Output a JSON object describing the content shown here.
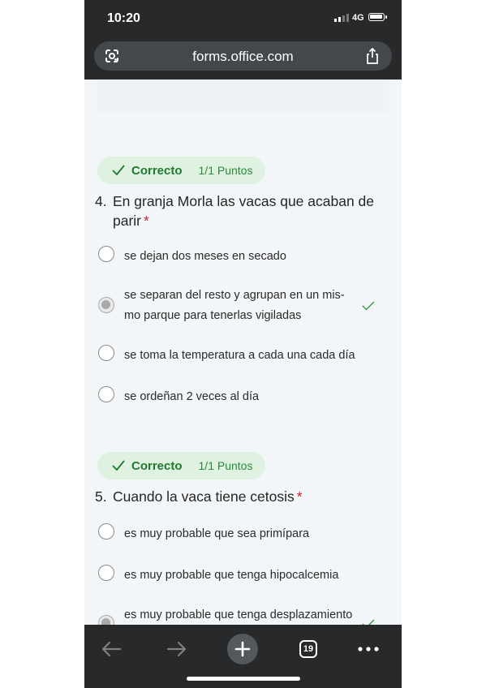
{
  "status_bar": {
    "time": "10:20",
    "network": "4G"
  },
  "browser": {
    "url": "forms.office.com",
    "tab_count": "19"
  },
  "questions": [
    {
      "badge_label": "Correcto",
      "badge_points": "1/1 Puntos",
      "number": "4.",
      "text": "En granja Morla las vacas que acaban de parir",
      "required": "*",
      "options": [
        {
          "text": "se dejan dos meses en secado",
          "selected": false
        },
        {
          "text": "se separan del resto y agrupan en un mis-mo parque para tenerlas vigiladas",
          "selected": true,
          "correct": true
        },
        {
          "text": "se toma la temperatura a cada una cada día",
          "selected": false
        },
        {
          "text": "se ordeñan 2 veces al día",
          "selected": false
        }
      ]
    },
    {
      "badge_label": "Correcto",
      "badge_points": "1/1 Puntos",
      "number": "5.",
      "text": "Cuando la vaca tiene cetosis",
      "required": "*",
      "options": [
        {
          "text": "es muy probable que sea primípara",
          "selected": false
        },
        {
          "text": "es muy probable que tenga hipocalcemia",
          "selected": false
        },
        {
          "text": "es muy probable que tenga desplazamiento",
          "selected": true,
          "correct": true
        }
      ]
    }
  ],
  "icons": {
    "lens": "google-lens-icon",
    "share": "share-icon",
    "back": "back-arrow-icon",
    "forward": "forward-arrow-icon",
    "new_tab": "plus-icon",
    "tabs": "tabs-icon",
    "menu": "more-dots-icon",
    "check": "check-icon"
  },
  "colors": {
    "badge_bg": "#dff2e2",
    "badge_text": "#1f7a2c",
    "required": "#c4262e",
    "chrome_bar": "#27292b",
    "page_bg": "#f3f6f8"
  }
}
